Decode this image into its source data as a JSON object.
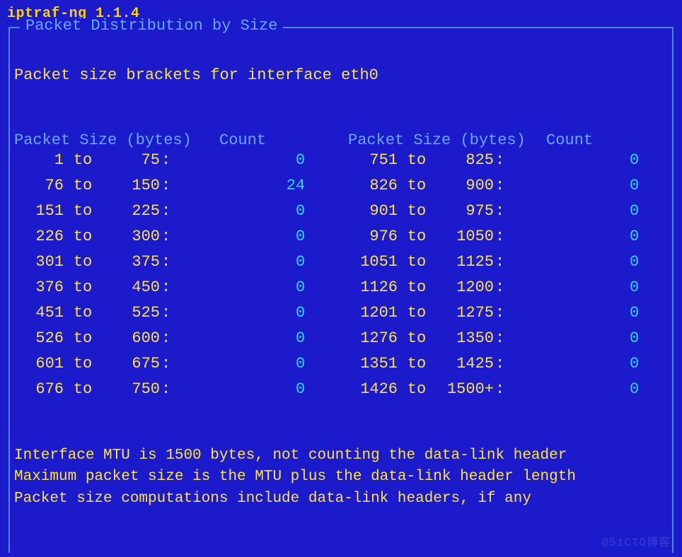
{
  "app": {
    "title": "iptraf-ng 1.1.4"
  },
  "panel": {
    "title": "Packet Distribution by Size",
    "subtitle": "Packet size brackets for interface eth0"
  },
  "headers": {
    "size_label": "Packet Size (bytes)",
    "count_label": "Count"
  },
  "brackets_left": [
    {
      "from": "1",
      "to": "75",
      "count": "0"
    },
    {
      "from": "76",
      "to": "150",
      "count": "24"
    },
    {
      "from": "151",
      "to": "225",
      "count": "0"
    },
    {
      "from": "226",
      "to": "300",
      "count": "0"
    },
    {
      "from": "301",
      "to": "375",
      "count": "0"
    },
    {
      "from": "376",
      "to": "450",
      "count": "0"
    },
    {
      "from": "451",
      "to": "525",
      "count": "0"
    },
    {
      "from": "526",
      "to": "600",
      "count": "0"
    },
    {
      "from": "601",
      "to": "675",
      "count": "0"
    },
    {
      "from": "676",
      "to": "750",
      "count": "0"
    }
  ],
  "brackets_right": [
    {
      "from": "751",
      "to": "825",
      "count": "0"
    },
    {
      "from": "826",
      "to": "900",
      "count": "0"
    },
    {
      "from": "901",
      "to": "975",
      "count": "0"
    },
    {
      "from": "976",
      "to": "1050",
      "count": "0"
    },
    {
      "from": "1051",
      "to": "1125",
      "count": "0"
    },
    {
      "from": "1126",
      "to": "1200",
      "count": "0"
    },
    {
      "from": "1201",
      "to": "1275",
      "count": "0"
    },
    {
      "from": "1276",
      "to": "1350",
      "count": "0"
    },
    {
      "from": "1351",
      "to": "1425",
      "count": "0"
    },
    {
      "from": "1426",
      "to": "1500+",
      "count": "0"
    }
  ],
  "to_word": "to",
  "footer": {
    "l1": "Interface MTU is 1500 bytes, not counting the data-link header",
    "l2": "Maximum packet size is the MTU plus the data-link header length",
    "l3": "Packet size computations include data-link headers, if any"
  },
  "watermark": "@51CTO博客"
}
